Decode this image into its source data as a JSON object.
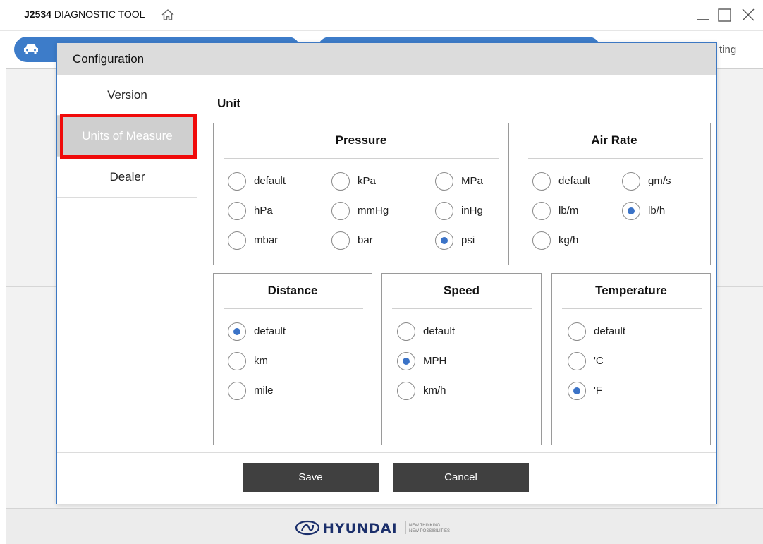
{
  "window": {
    "title_bold": "J2534",
    "title_rest": " DIAGNOSTIC TOOL",
    "icons": [
      "home-icon",
      "minimize-icon",
      "maximize-icon",
      "close-icon"
    ]
  },
  "background": {
    "setting_fragment": "ting",
    "brand": "HYUNDAI",
    "brand_tagline_1": "NEW THINKING",
    "brand_tagline_2": "NEW POSSIBILITIES",
    "accent_color": "#3d7cc9"
  },
  "dialog": {
    "title": "Configuration",
    "sidebar": [
      {
        "label": "Version"
      },
      {
        "label": "Units of Measure"
      },
      {
        "label": "Dealer"
      }
    ],
    "active_sidebar": "Units of Measure",
    "unit_heading": "Unit",
    "groups": {
      "pressure": {
        "title": "Pressure",
        "options": [
          "default",
          "kPa",
          "MPa",
          "hPa",
          "mmHg",
          "inHg",
          "mbar",
          "bar",
          "psi"
        ],
        "selected": "psi"
      },
      "air_rate": {
        "title": "Air Rate",
        "options": [
          "default",
          "gm/s",
          "lb/m",
          "lb/h",
          "kg/h"
        ],
        "selected": "lb/h"
      },
      "distance": {
        "title": "Distance",
        "options": [
          "default",
          "km",
          "mile"
        ],
        "selected": "default"
      },
      "speed": {
        "title": "Speed",
        "options": [
          "default",
          "MPH",
          "km/h"
        ],
        "selected": "MPH"
      },
      "temperature": {
        "title": "Temperature",
        "options": [
          "default",
          "'C",
          "'F"
        ],
        "selected": "'F"
      }
    },
    "buttons": {
      "save": "Save",
      "cancel": "Cancel"
    },
    "highlight_color": "#f00a0a",
    "radio_color": "#3b73c7"
  }
}
